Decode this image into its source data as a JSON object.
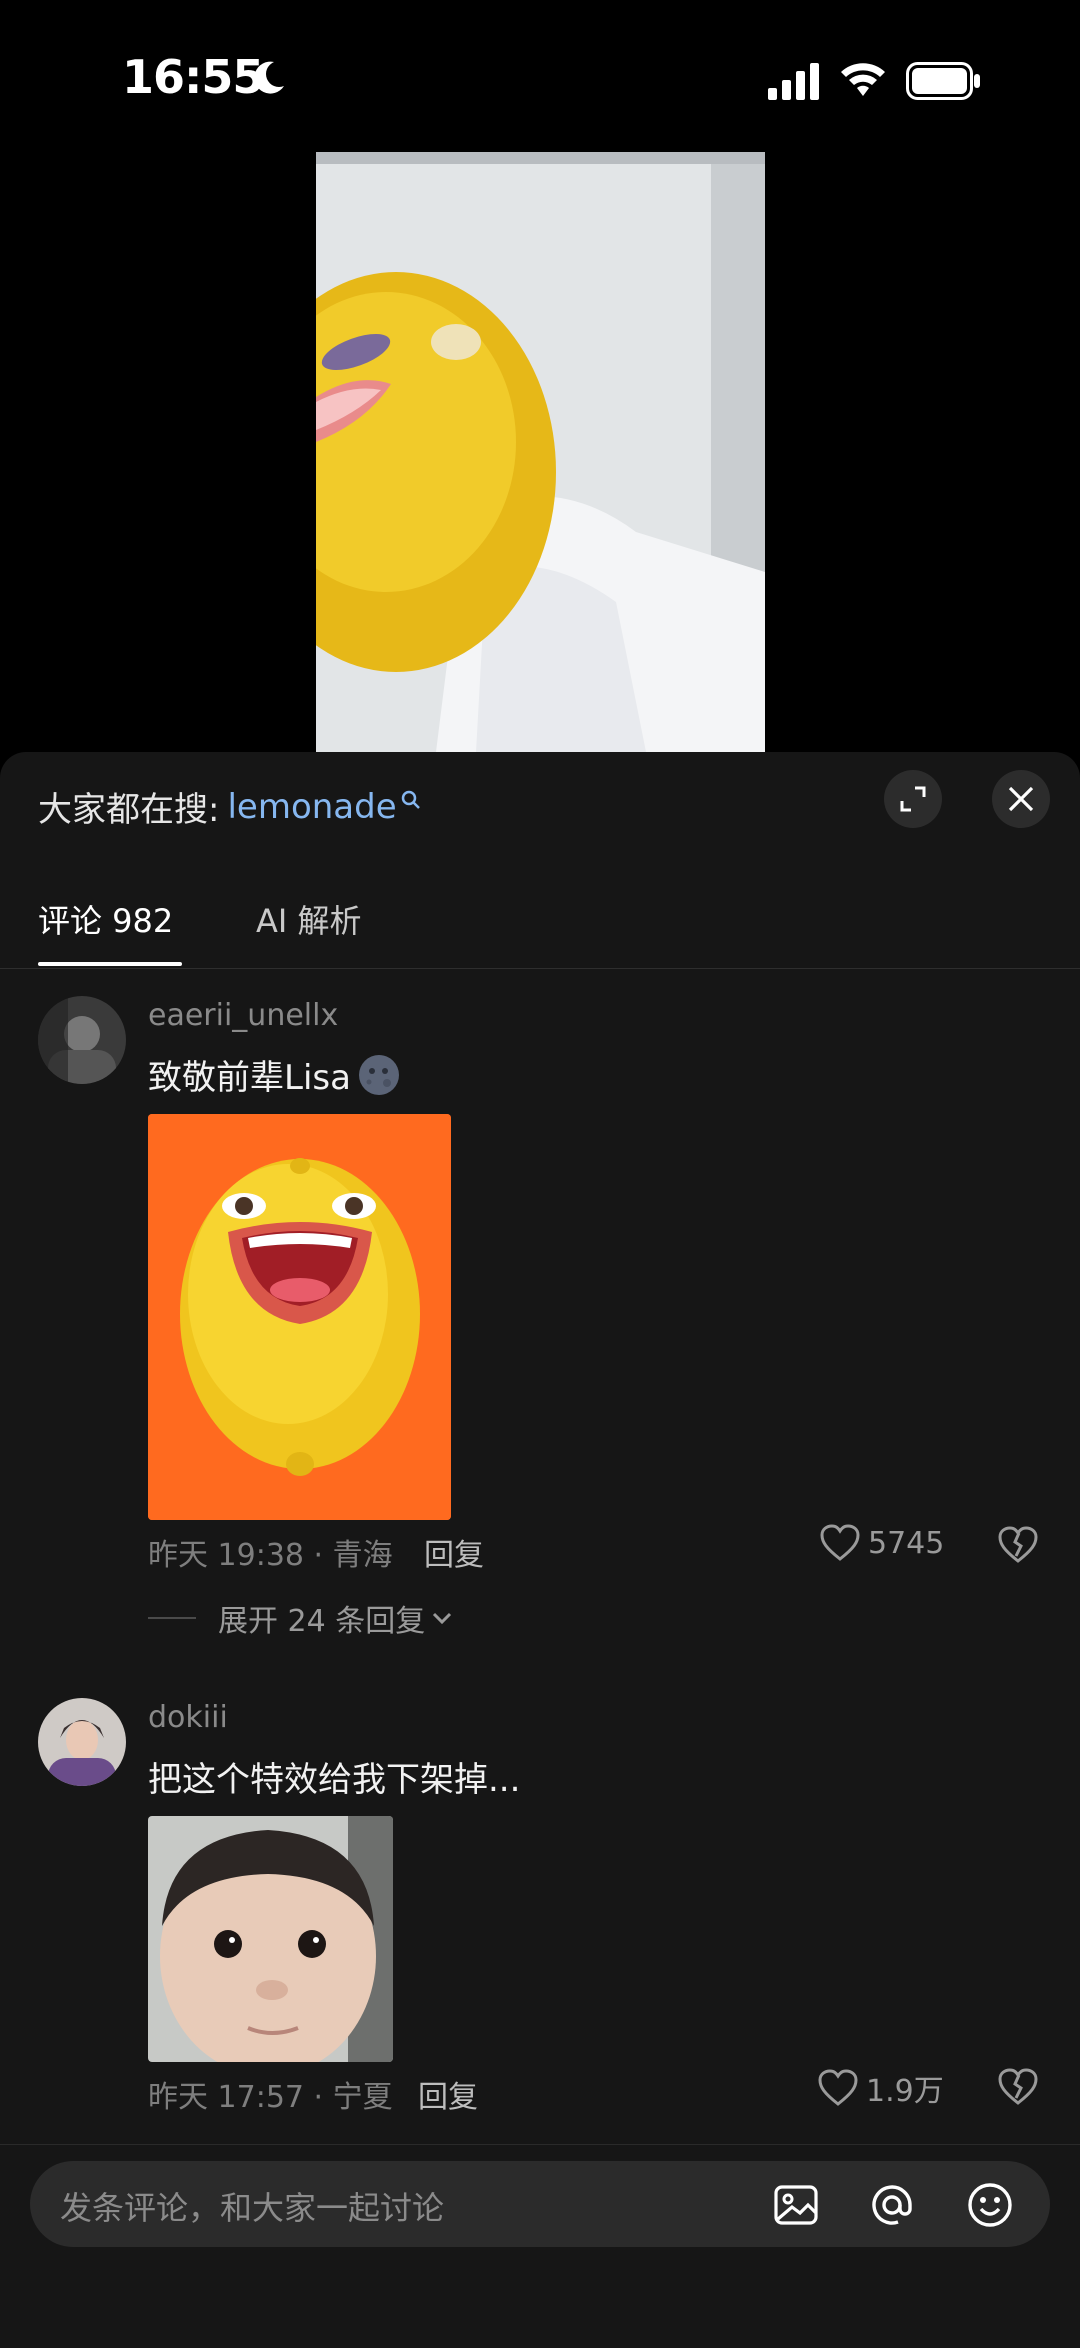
{
  "status_bar": {
    "time": "16:55",
    "icons": [
      "moon-icon",
      "cellular-signal-icon",
      "wifi-icon",
      "battery-icon"
    ]
  },
  "video": {
    "icon": "video-frame"
  },
  "sheet": {
    "search_prefix": "大家都在搜:",
    "search_term": "lemonade",
    "tabs": [
      {
        "label": "评论 982",
        "active": true
      },
      {
        "label": "AI 解析",
        "active": false
      }
    ]
  },
  "comments": [
    {
      "username": "eaerii_unellx",
      "text": "致敬前辈Lisa",
      "emoji": "moon-face-emoji",
      "sticker": "lemon-face-sticker",
      "meta": "昨天 19:38 · 青海",
      "reply_label": "回复",
      "likes": "5745",
      "expand_label": "展开 24 条回复"
    },
    {
      "username": "dokiii",
      "text": "把这个特效给我下架掉...",
      "sticker": "baby-face-sticker",
      "meta": "昨天 17:57 · 宁夏",
      "reply_label": "回复",
      "likes": "1.9万"
    }
  ],
  "input": {
    "placeholder": "发条评论，和大家一起讨论",
    "icons": [
      "image-icon",
      "at-icon",
      "emoji-icon"
    ]
  },
  "colors": {
    "accent_link": "#86b7f0",
    "sheet_bg": "#161616",
    "sticker_orange": "#ff6a1f"
  }
}
